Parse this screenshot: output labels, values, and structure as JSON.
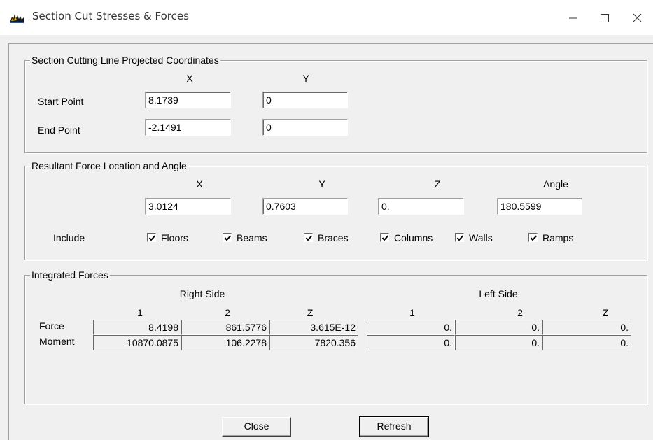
{
  "window": {
    "title": "Section Cut Stresses & Forces",
    "icon": "app-icon"
  },
  "cutting_line": {
    "legend": "Section Cutting Line Projected Coordinates",
    "col_x": "X",
    "col_y": "Y",
    "start_label": "Start Point",
    "start_x": "8.1739",
    "start_y": "0",
    "end_label": "End Point",
    "end_x": "-2.1491",
    "end_y": "0"
  },
  "resultant": {
    "legend": "Resultant Force Location and Angle",
    "col_x": "X",
    "col_y": "Y",
    "col_z": "Z",
    "col_angle": "Angle",
    "x": "3.0124",
    "y": "0.7603",
    "z": "0.",
    "angle": "180.5599",
    "include_label": "Include",
    "include": [
      {
        "label": "Floors",
        "checked": true
      },
      {
        "label": "Beams",
        "checked": true
      },
      {
        "label": "Braces",
        "checked": true
      },
      {
        "label": "Columns",
        "checked": true
      },
      {
        "label": "Walls",
        "checked": true
      },
      {
        "label": "Ramps",
        "checked": true
      }
    ]
  },
  "integrated": {
    "legend": "Integrated Forces",
    "right_side": "Right Side",
    "left_side": "Left Side",
    "col1": "1",
    "col2": "2",
    "colz": "Z",
    "force_label": "Force",
    "moment_label": "Moment",
    "force_right": [
      "8.4198",
      "861.5776",
      "3.615E-12"
    ],
    "force_left": [
      "0.",
      "0.",
      "0."
    ],
    "moment_right": [
      "10870.0875",
      "106.2278",
      "7820.356"
    ],
    "moment_left": [
      "0.",
      "0.",
      "0."
    ]
  },
  "buttons": {
    "close": "Close",
    "refresh": "Refresh"
  }
}
